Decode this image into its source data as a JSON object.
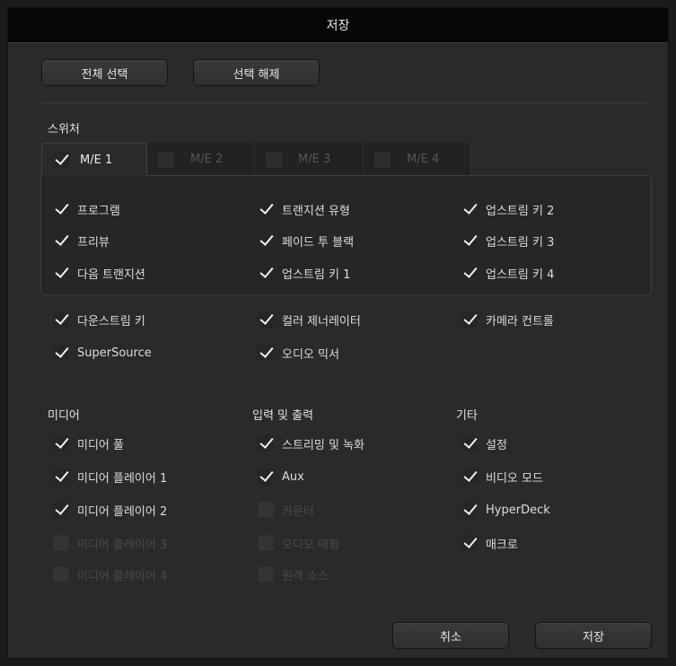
{
  "title": "저장",
  "select_all": "전체 선택",
  "deselect": "선택 해제",
  "switcher_heading": "스위처",
  "tabs": [
    {
      "label": "M/E 1",
      "checked": true
    },
    {
      "label": "M/E 2",
      "checked": false
    },
    {
      "label": "M/E 3",
      "checked": false
    },
    {
      "label": "M/E 4",
      "checked": false
    }
  ],
  "me": {
    "program": "프로그램",
    "transition_type": "트랜지션 유형",
    "upstream_key2": "업스트림 키 2",
    "preview": "프리뷰",
    "fade_to_black": "페이드 투 블랙",
    "upstream_key3": "업스트림 키 3",
    "next_transition": "다음 트랜지션",
    "upstream_key1": "업스트림 키 1",
    "upstream_key4": "업스트림 키 4"
  },
  "general": {
    "downstream_key": "다운스트림 키",
    "color_generator": "컬러 제너레이터",
    "camera_control": "카메라 컨트롤",
    "supersource": "SuperSource",
    "audio_mixer": "오디오 믹서"
  },
  "media": {
    "heading": "미디어",
    "pool": "미디어 풀",
    "player1": "미디어 플레이어 1",
    "player2": "미디어 플레이어 2",
    "player3": "미디어 플레이어 3",
    "player4": "미디어 플레이어 4"
  },
  "io": {
    "heading": "입력 및 출력",
    "streaming": "스트리밍 및 녹화",
    "aux": "Aux",
    "counter": "카운터",
    "audio_mapping": "오디오 매핑",
    "remote_source": "원격 소스"
  },
  "other": {
    "heading": "기타",
    "settings": "설정",
    "video_mode": "비디오 모드",
    "hyperdeck": "HyperDeck",
    "macro": "매크로"
  },
  "cancel": "취소",
  "save": "저장"
}
